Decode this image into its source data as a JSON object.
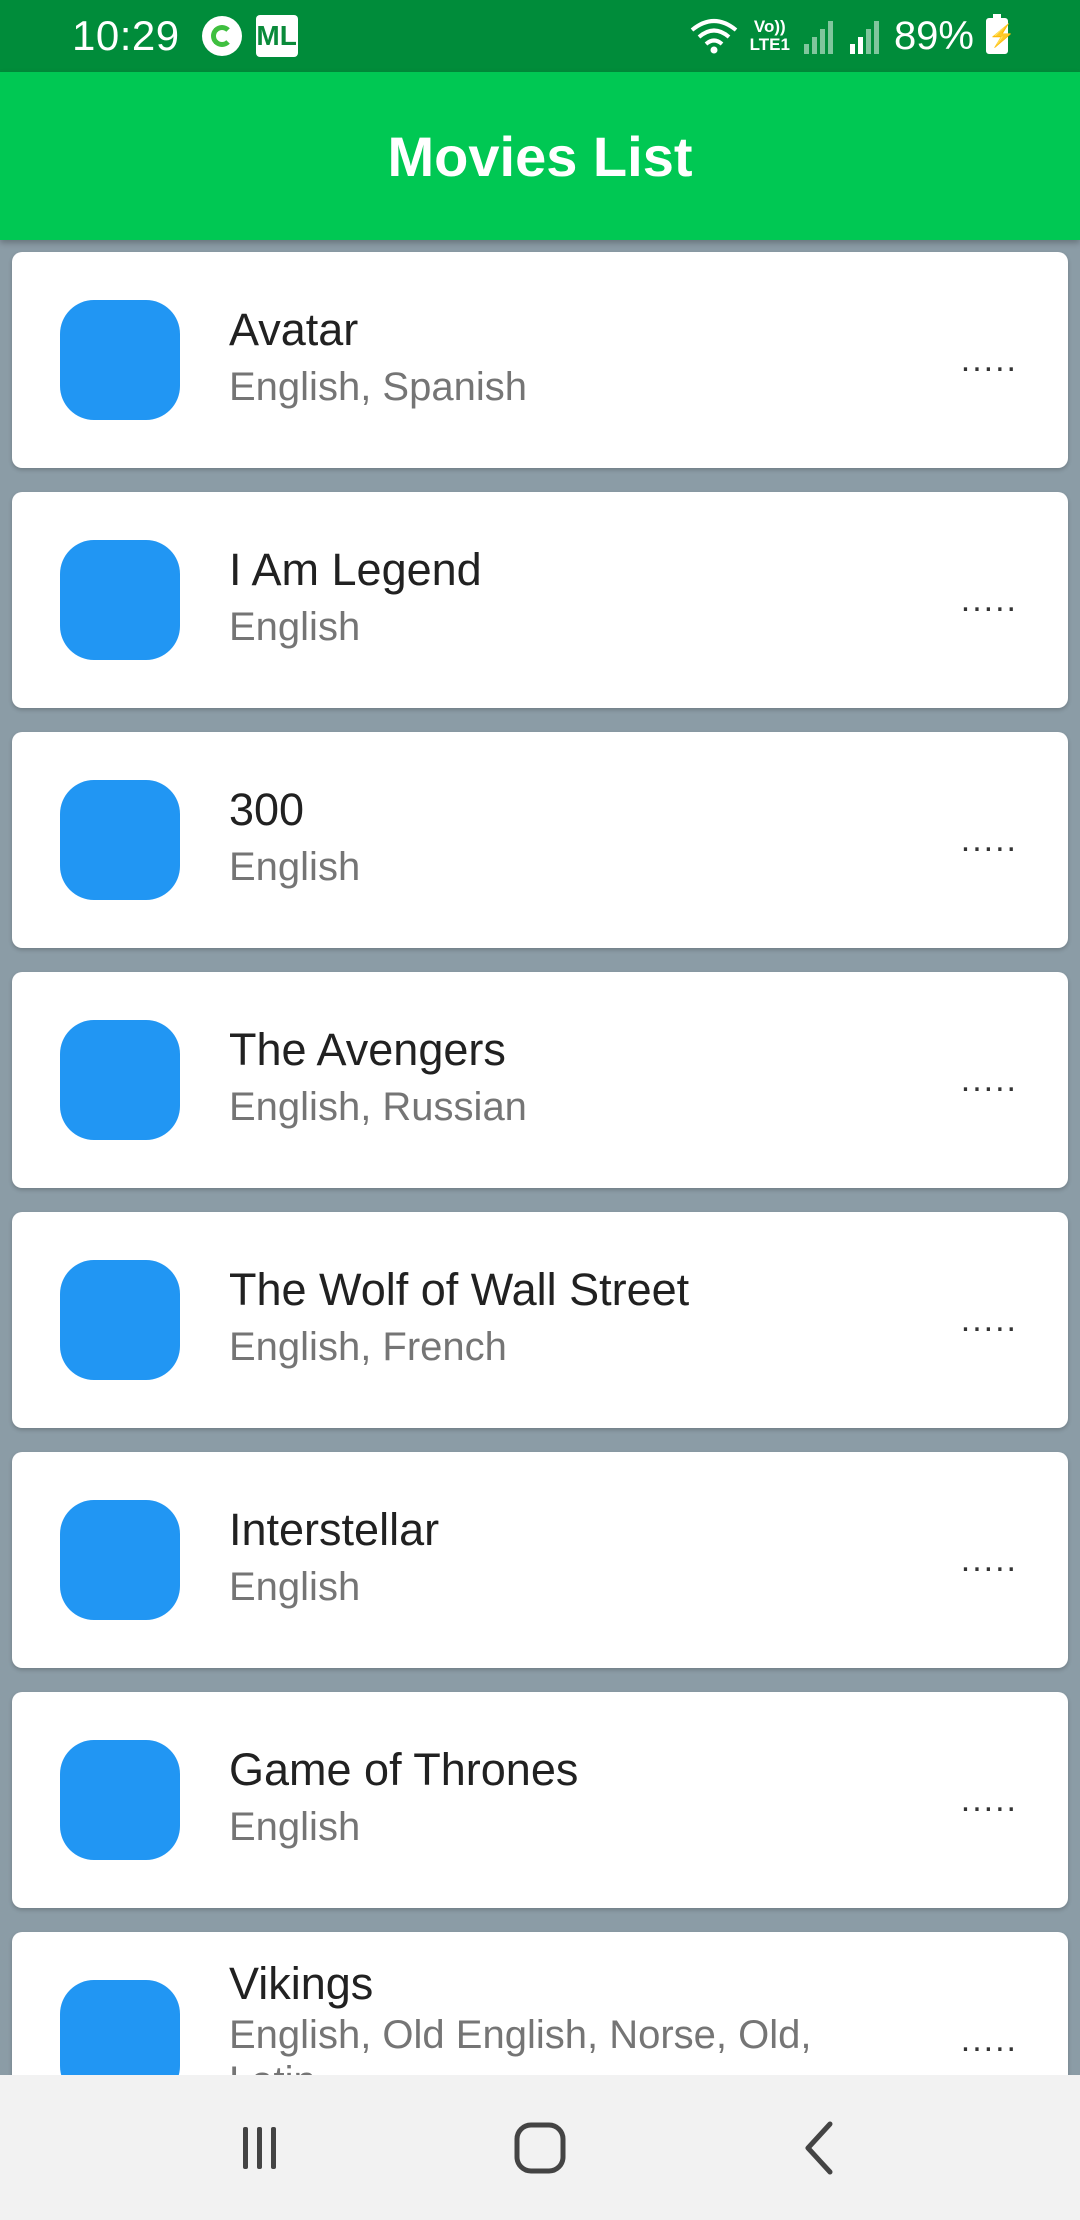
{
  "status_bar": {
    "time": "10:29",
    "ml_label": "ML",
    "volte_top": "Vo))",
    "volte_bottom": "LTE1",
    "battery": "89%"
  },
  "app_bar": {
    "title": "Movies List"
  },
  "colors": {
    "app_bar": "#00c853",
    "status_bar": "#008c3a",
    "thumbnail": "#2196f3"
  },
  "movies": [
    {
      "title": "Avatar",
      "languages": "English, Spanish",
      "more": "....."
    },
    {
      "title": "I Am Legend",
      "languages": "English",
      "more": "....."
    },
    {
      "title": "300",
      "languages": "English",
      "more": "....."
    },
    {
      "title": "The Avengers",
      "languages": "English, Russian",
      "more": "....."
    },
    {
      "title": "The Wolf of Wall Street",
      "languages": "English, French",
      "more": "....."
    },
    {
      "title": "Interstellar",
      "languages": "English",
      "more": "....."
    },
    {
      "title": "Game of Thrones",
      "languages": "English",
      "more": "....."
    },
    {
      "title": "Vikings",
      "languages": "English, Old English, Norse, Old, Latin",
      "more": "....."
    }
  ],
  "nav_bar": {
    "icons": [
      "recent-apps-icon",
      "home-icon",
      "back-icon"
    ]
  }
}
